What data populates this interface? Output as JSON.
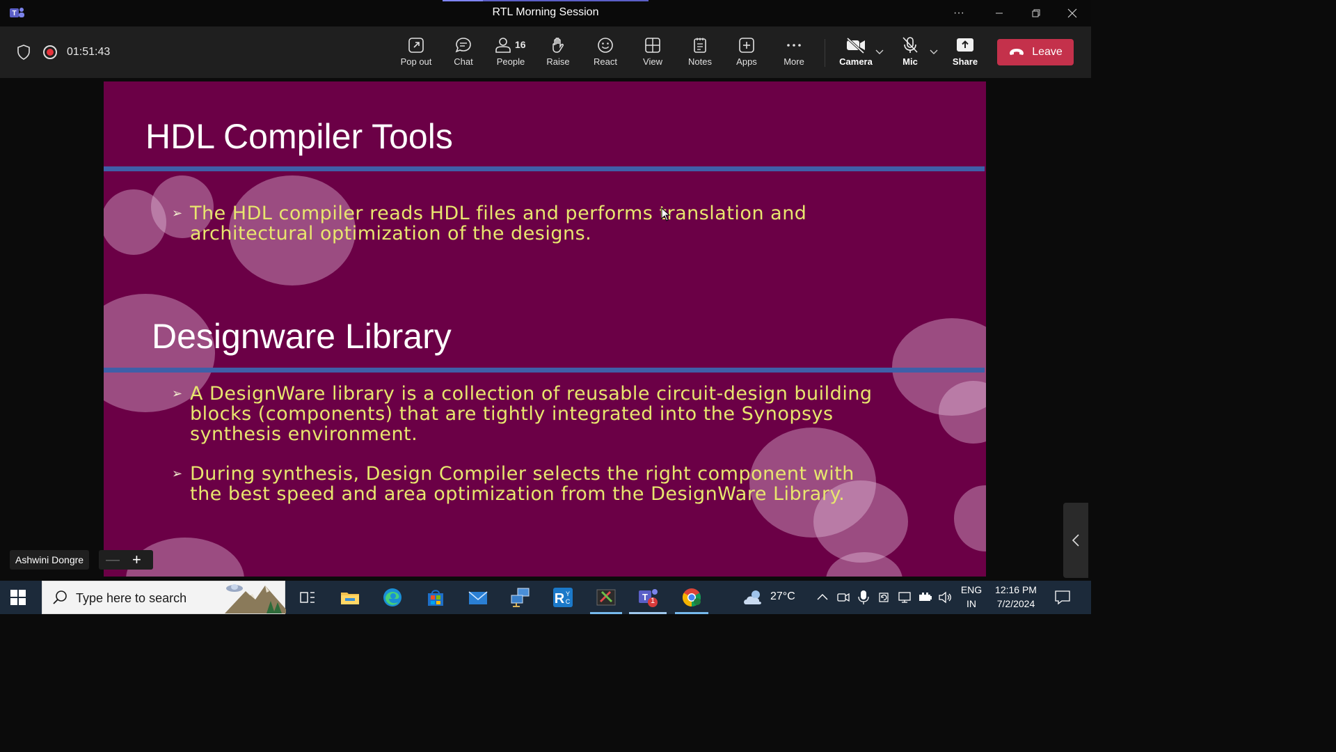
{
  "window": {
    "title": "RTL Morning Session"
  },
  "meeting": {
    "timer": "01:51:43",
    "toolbar": [
      {
        "id": "pop-out",
        "label": "Pop out"
      },
      {
        "id": "chat",
        "label": "Chat"
      },
      {
        "id": "people",
        "label": "People",
        "count": "16"
      },
      {
        "id": "raise",
        "label": "Raise"
      },
      {
        "id": "react",
        "label": "React"
      },
      {
        "id": "view",
        "label": "View"
      },
      {
        "id": "notes",
        "label": "Notes"
      },
      {
        "id": "apps",
        "label": "Apps"
      },
      {
        "id": "more",
        "label": "More"
      },
      {
        "id": "camera",
        "label": "Camera"
      },
      {
        "id": "mic",
        "label": "Mic"
      },
      {
        "id": "share",
        "label": "Share"
      }
    ],
    "leave_label": "Leave",
    "presenter": "Ashwini Dongre"
  },
  "slide": {
    "title1": "HDL Compiler Tools",
    "bullet1": "The HDL compiler reads HDL files and performs translation and architectural optimization of the designs.",
    "title2": "Designware Library",
    "bullet2": "A DesignWare library is a collection of reusable circuit-design building blocks (components) that are tightly integrated into the Synopsys synthesis environment.",
    "bullet3": "During synthesis, Design Compiler selects the right component with the best speed and area optimization from the DesignWare Library."
  },
  "taskbar": {
    "search_placeholder": "Type here to search",
    "weather": "27°C",
    "language_line1": "ENG",
    "language_line2": "IN",
    "time": "12:16 PM",
    "date": "7/2/2024",
    "teams_badge": "1"
  },
  "colors": {
    "slide_bg": "#6b0046",
    "bullet_text": "#e8e66e",
    "rule": "#3f5fa8",
    "leave": "#c4314b"
  }
}
